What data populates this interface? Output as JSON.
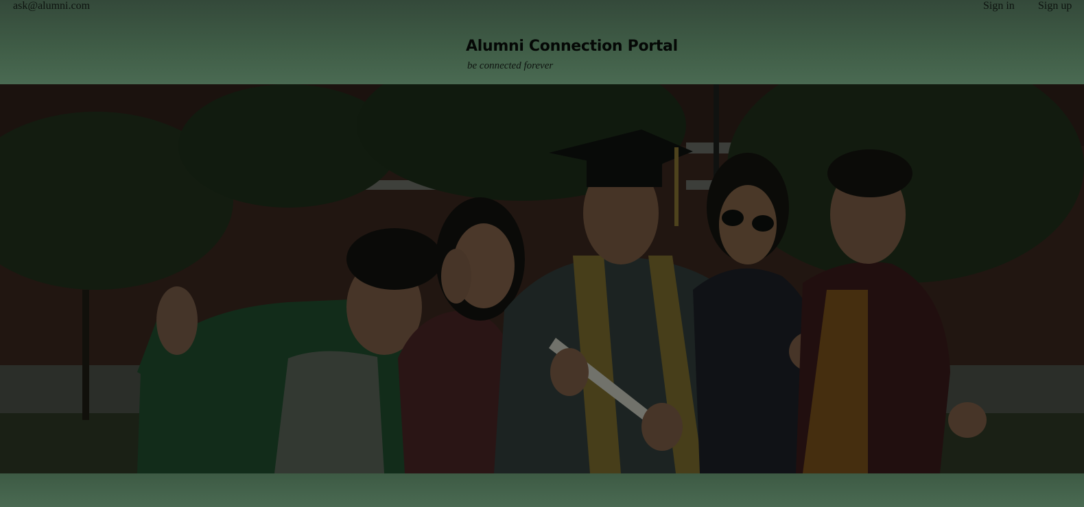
{
  "header": {
    "contact_email": "ask@alumni.com",
    "sign_in_label": "Sign in",
    "sign_up_label": "Sign up",
    "brand_title": "Alumni Connection Portal",
    "brand_tagline": "be connected forever"
  },
  "hero": {
    "image_subject": "graduates-group-photo"
  },
  "colors": {
    "header_bg": "#3f5c46",
    "footer_bg": "#466650",
    "overlay": "#1c2a1f"
  }
}
